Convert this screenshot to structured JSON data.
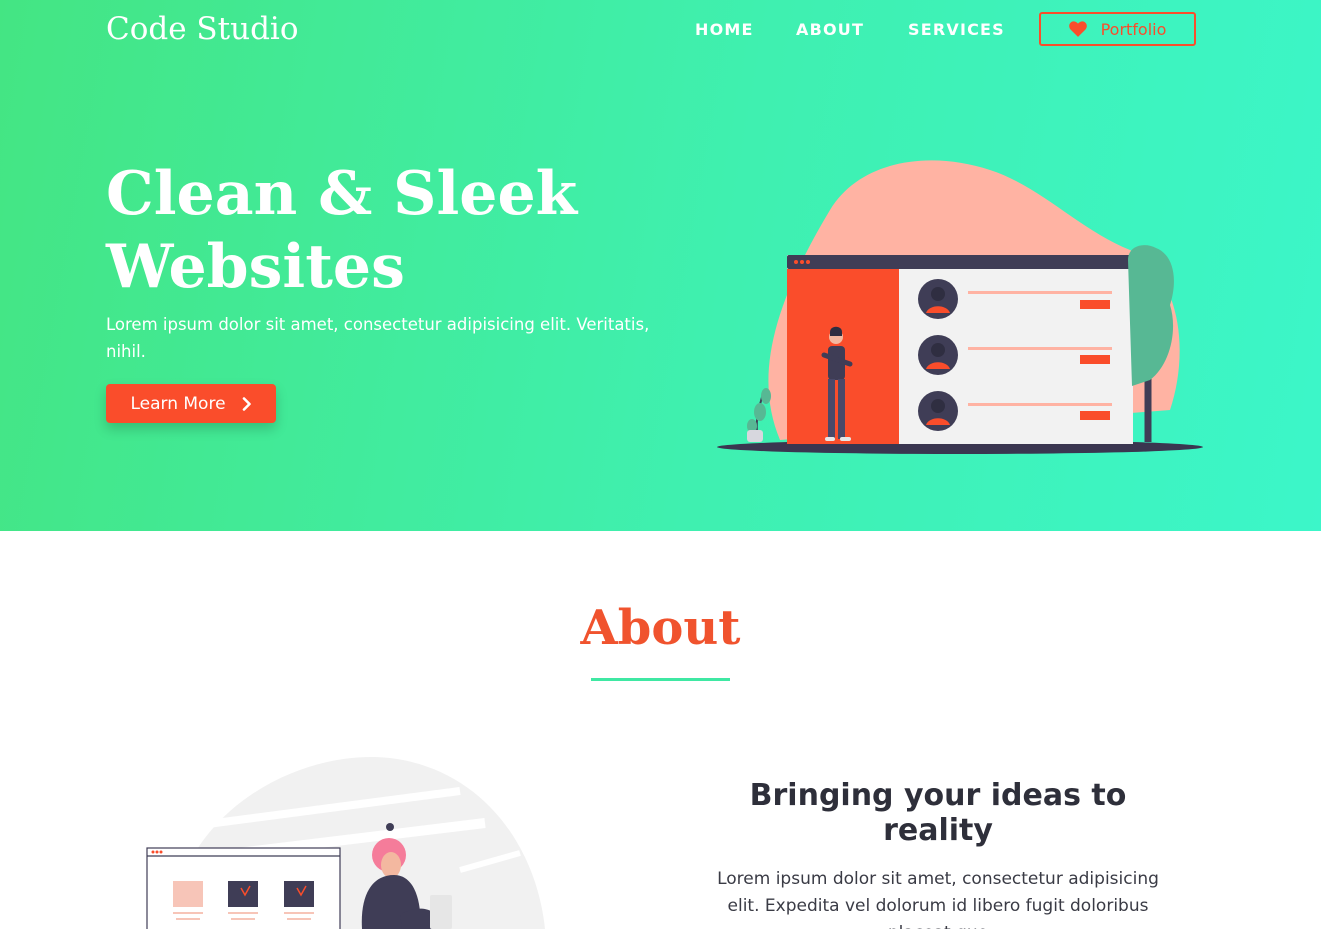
{
  "header": {
    "brand": "Code Studio",
    "nav": {
      "home": "HOME",
      "about": "ABOUT",
      "services": "SERVICES",
      "portfolio": "Portfolio"
    }
  },
  "hero": {
    "title_line1": "Clean & Sleek",
    "title_line2": "Websites",
    "text": "Lorem ipsum dolor sit amet, consectetur adipisicing elit. Veritatis, nihil.",
    "cta_label": "Learn More"
  },
  "about": {
    "title": "About",
    "subtitle": "Bringing your ideas to reality",
    "text": "Lorem ipsum dolor sit amet, consectetur adipisicing elit. Expedita vel dolorum id libero fugit doloribus placeat quo"
  },
  "icons": {
    "portfolio": "heart-icon",
    "cta": "chevron-right-icon"
  },
  "colors": {
    "accent": "#fa4d2b",
    "gradient_start": "#44e583",
    "gradient_end": "#3cf6c9",
    "heading_dark": "#2e2f3a",
    "underline": "#3fe8a3"
  }
}
